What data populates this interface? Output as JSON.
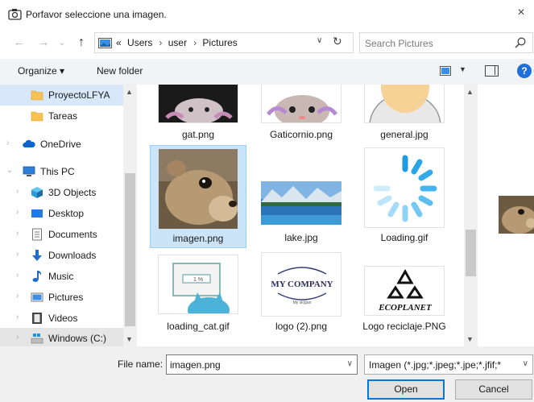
{
  "window": {
    "title": "Porfavor seleccione una imagen.",
    "close_glyph": "×"
  },
  "navigation": {
    "back_glyph": "←",
    "forward_glyph": "→",
    "recent_glyph": "⌄",
    "up_glyph": "↑",
    "overflow_glyph": "«",
    "breadcrumb": [
      "Users",
      "user",
      "Pictures"
    ],
    "separator": "›",
    "refresh_glyph": "↻",
    "search_placeholder": "Search Pictures"
  },
  "toolbar": {
    "organize_label": "Organize ▾",
    "new_folder_label": "New folder",
    "help_label": "?"
  },
  "sidebar": {
    "items": [
      {
        "label": "ProyectoLFYA",
        "icon": "folder-icon",
        "selected": true
      },
      {
        "label": "Tareas",
        "icon": "folder-icon"
      },
      {
        "label": "OneDrive",
        "icon": "cloud-icon"
      },
      {
        "label": "This PC",
        "icon": "pc-icon"
      },
      {
        "label": "3D Objects",
        "icon": "cube-icon"
      },
      {
        "label": "Desktop",
        "icon": "desktop-icon"
      },
      {
        "label": "Documents",
        "icon": "document-icon"
      },
      {
        "label": "Downloads",
        "icon": "download-icon"
      },
      {
        "label": "Music",
        "icon": "music-icon"
      },
      {
        "label": "Pictures",
        "icon": "pictures-icon"
      },
      {
        "label": "Videos",
        "icon": "video-icon"
      },
      {
        "label": "Windows (C:)",
        "icon": "drive-icon",
        "highlighted": true
      }
    ]
  },
  "files": [
    {
      "name": "gat.png",
      "thumb": "cat-partial"
    },
    {
      "name": "Gaticornio.png",
      "thumb": "unicorn-cat"
    },
    {
      "name": "general.jpg",
      "thumb": "avatar"
    },
    {
      "name": "imagen.png",
      "thumb": "rodent",
      "selected": true
    },
    {
      "name": "lake.jpg",
      "thumb": "lake"
    },
    {
      "name": "Loading.gif",
      "thumb": "spinner"
    },
    {
      "name": "loading_cat.gif",
      "thumb": "loading-cat"
    },
    {
      "name": "logo (2).png",
      "thumb": "company-logo"
    },
    {
      "name": "Logo reciclaje.PNG",
      "thumb": "recycle-logo"
    }
  ],
  "thumb_text": {
    "company_logo": "MY COMPANY",
    "company_sub": "My slogan",
    "recycle_logo": "ECOPLANET",
    "loading_cat": "1 %"
  },
  "bottom": {
    "file_name_label": "File name:",
    "file_name_value": "imagen.png",
    "filter_value": "Imagen (*.jpg;*.jpeg;*.jpe;*.jfif;*",
    "open_label": "Open",
    "cancel_label": "Cancel"
  },
  "colors": {
    "accent": "#0078d7",
    "selection": "#cce4f7",
    "nav_selected": "#d9e7fb",
    "toolbar_bg": "#f1f3f6",
    "help_blue": "#1e6fd9"
  }
}
